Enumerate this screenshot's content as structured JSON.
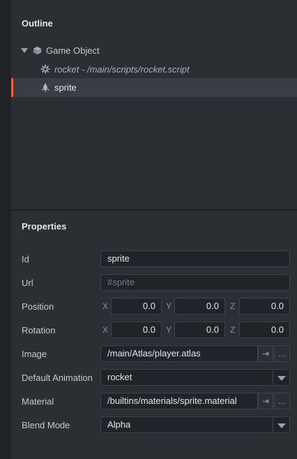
{
  "outline": {
    "title": "Outline",
    "tree": {
      "root_label": "Game Object",
      "script_label": "rocket - /main/scripts/rocket.script",
      "sprite_label": "sprite"
    }
  },
  "properties": {
    "title": "Properties",
    "id": {
      "label": "Id",
      "value": "sprite"
    },
    "url": {
      "label": "Url",
      "placeholder": "#sprite"
    },
    "position": {
      "label": "Position",
      "x_axis": "X",
      "y_axis": "Y",
      "z_axis": "Z",
      "x": "0.0",
      "y": "0.0",
      "z": "0.0"
    },
    "rotation": {
      "label": "Rotation",
      "x_axis": "X",
      "y_axis": "Y",
      "z_axis": "Z",
      "x": "0.0",
      "y": "0.0",
      "z": "0.0"
    },
    "image": {
      "label": "Image",
      "value": "/main/Atlas/player.atlas",
      "goto_glyph": "⇥",
      "browse_glyph": "…"
    },
    "default_animation": {
      "label": "Default Animation",
      "value": "rocket"
    },
    "material": {
      "label": "Material",
      "value": "/builtins/materials/sprite.material",
      "goto_glyph": "⇥",
      "browse_glyph": "…"
    },
    "blend_mode": {
      "label": "Blend Mode",
      "value": "Alpha"
    }
  },
  "colors": {
    "selection_accent": "#e8653b"
  }
}
